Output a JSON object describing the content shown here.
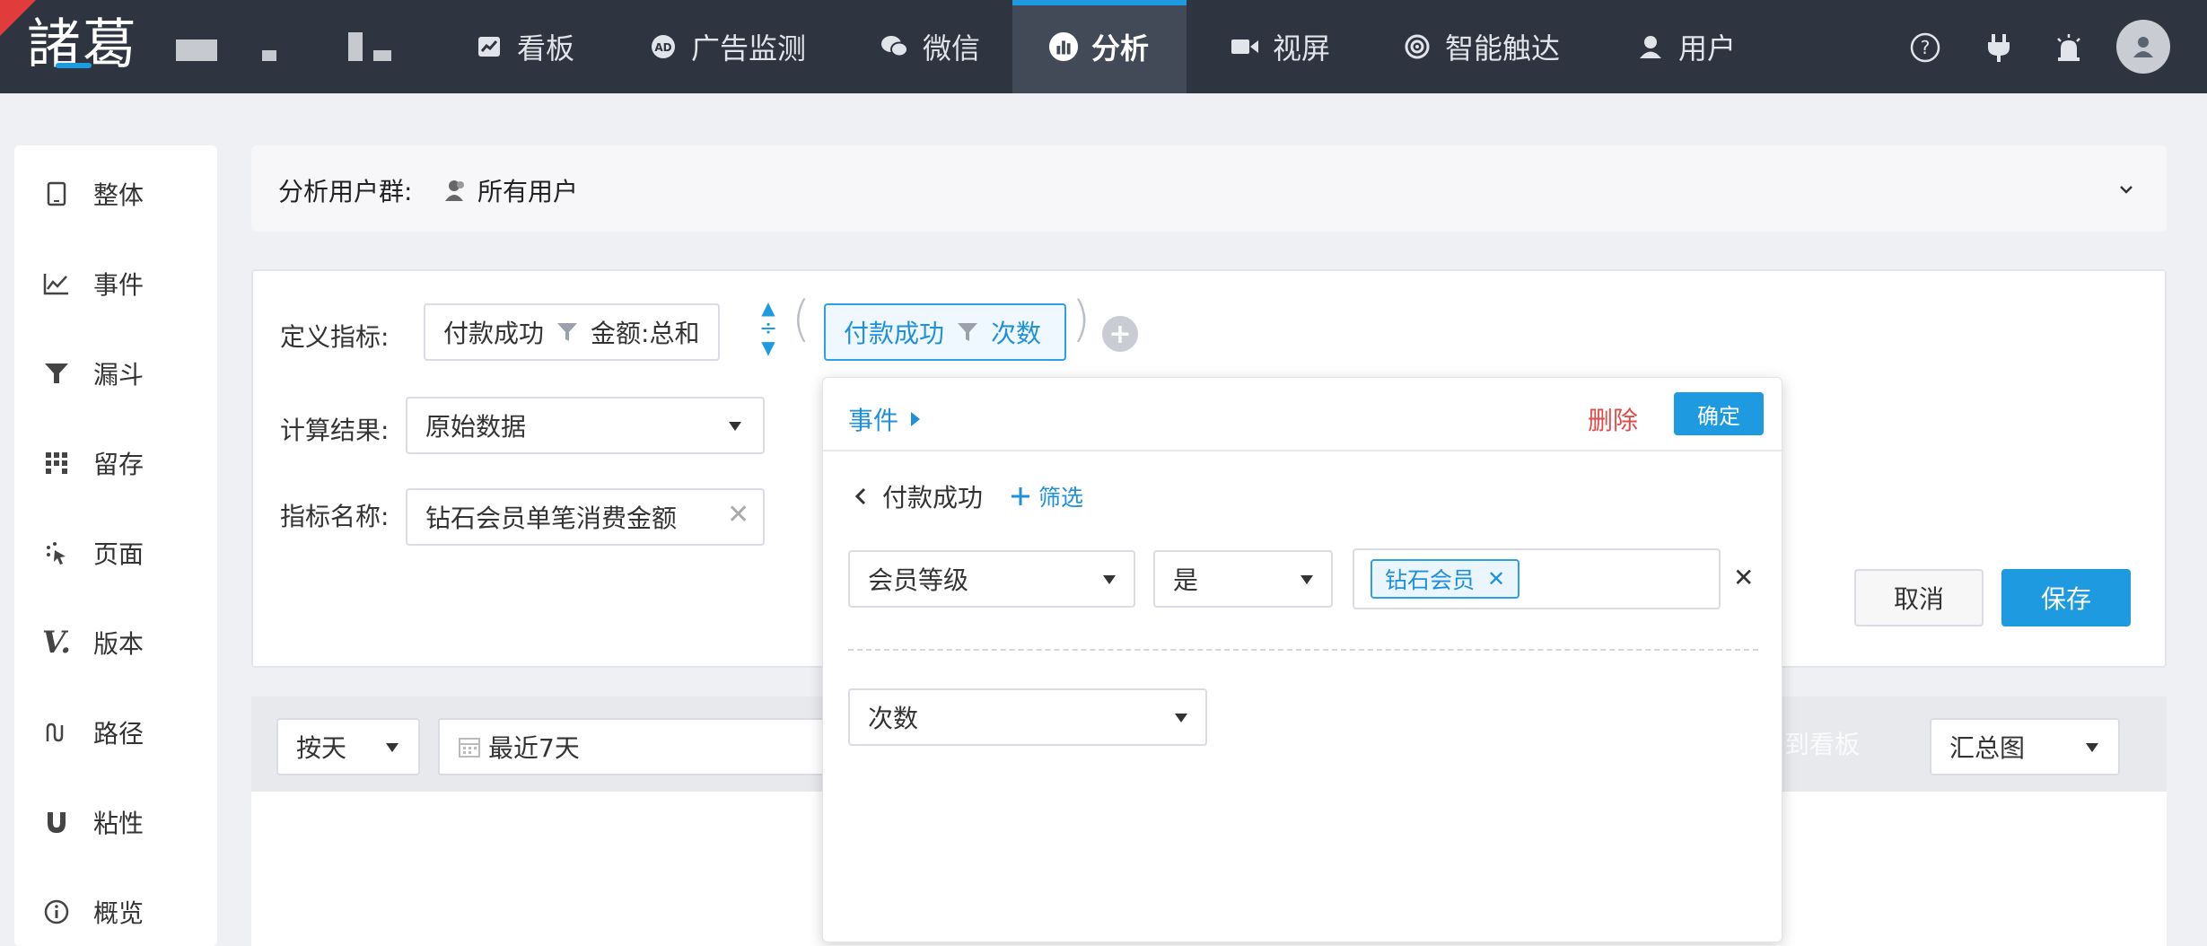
{
  "topbar": {
    "logo": "諸葛",
    "nav": [
      {
        "label": "看板",
        "icon": "chart-line-icon"
      },
      {
        "label": "广告监测",
        "icon": "ad-icon"
      },
      {
        "label": "微信",
        "icon": "wechat-icon"
      },
      {
        "label": "分析",
        "icon": "analysis-icon",
        "active": true
      },
      {
        "label": "视屏",
        "icon": "video-icon"
      },
      {
        "label": "智能触达",
        "icon": "target-icon"
      },
      {
        "label": "用户",
        "icon": "user-icon"
      }
    ],
    "right_icons": [
      "help-icon",
      "plug-icon",
      "alarm-icon",
      "avatar-icon"
    ]
  },
  "sidebar": {
    "items": [
      {
        "label": "整体",
        "icon": "tablet-icon"
      },
      {
        "label": "事件",
        "icon": "line-chart-icon"
      },
      {
        "label": "漏斗",
        "icon": "funnel-icon"
      },
      {
        "label": "留存",
        "icon": "grid-icon"
      },
      {
        "label": "页面",
        "icon": "click-icon"
      },
      {
        "label": "版本",
        "icon": "version-icon"
      },
      {
        "label": "路径",
        "icon": "path-icon"
      },
      {
        "label": "粘性",
        "icon": "magnet-icon"
      },
      {
        "label": "概览",
        "icon": "info-icon"
      }
    ]
  },
  "group": {
    "label": "分析用户群:",
    "value": "所有用户"
  },
  "define": {
    "metric_label": "定义指标:",
    "left_event": "付款成功",
    "left_agg": "金额:总和",
    "operator": "÷",
    "right_event": "付款成功",
    "right_agg": "次数",
    "result_label": "计算结果:",
    "result_value": "原始数据",
    "name_label": "指标名称:",
    "name_value": "钻石会员单笔消费金额",
    "cancel": "取消",
    "save": "保存"
  },
  "toolbar": {
    "granularity": "按天",
    "date_range": "最近7天",
    "add_to_board": "加到看板",
    "chart_type": "汇总图"
  },
  "popup": {
    "title": "事件",
    "delete": "删除",
    "confirm": "确定",
    "event_name": "付款成功",
    "add_filter": "筛选",
    "filter_field": "会员等级",
    "filter_op": "是",
    "filter_tag": "钻石会员",
    "measure": "次数"
  },
  "colors": {
    "accent": "#1e9be0",
    "topbar": "#2f3540",
    "danger": "#e04b4b"
  }
}
